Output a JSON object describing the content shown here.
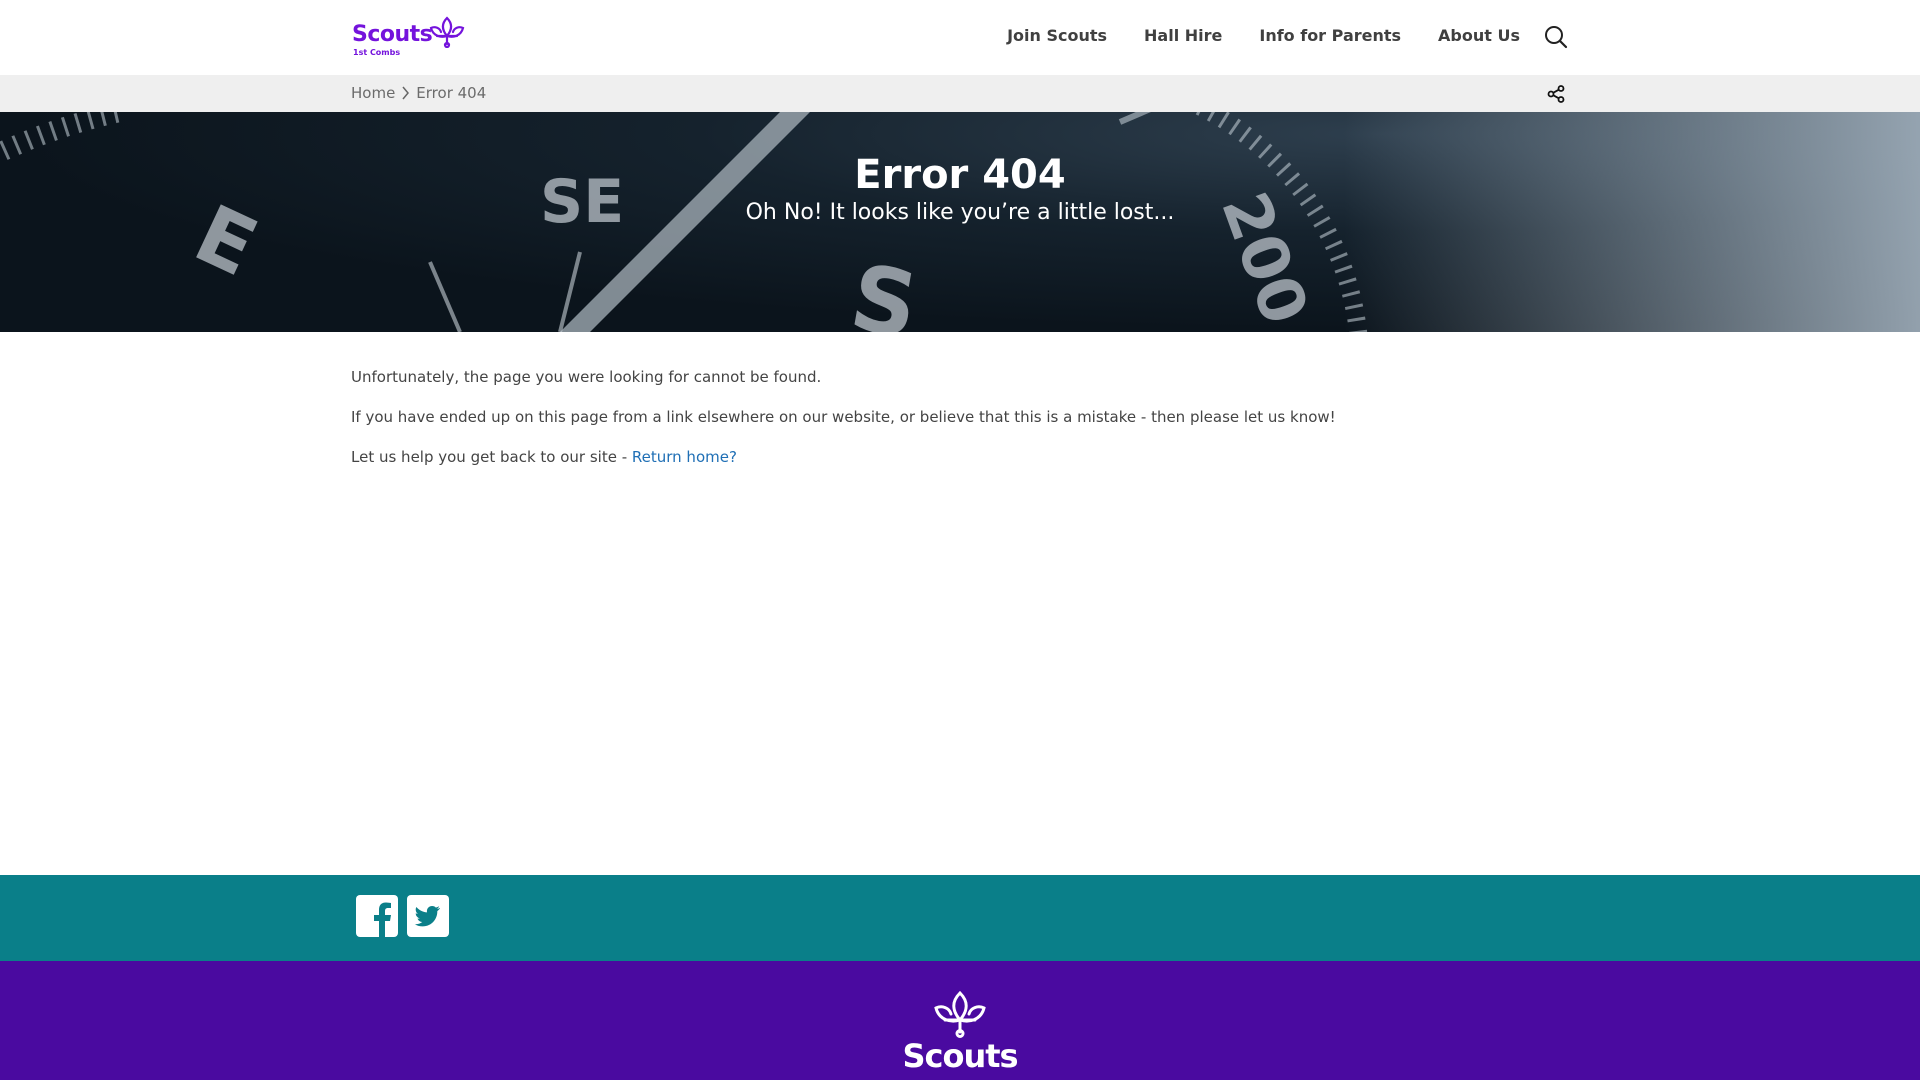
{
  "header": {
    "logo_text": "Scouts",
    "logo_sub": "1st Combs",
    "nav": [
      "Join Scouts",
      "Hall Hire",
      "Info for Parents",
      "About Us"
    ],
    "search_icon": "search-icon"
  },
  "breadcrumb": {
    "home": "Home",
    "current": "Error 404",
    "share_icon": "share-icon"
  },
  "hero": {
    "title": "Error 404",
    "subtitle": "Oh No! It looks like you’re a little lost..."
  },
  "content": {
    "p1": "Unfortunately, the page you were looking for cannot be found.",
    "p2": "If you have ended up on this page from a link elsewhere on our website, or believe that this is a mistake - then please let us know!",
    "p3_prefix": "Let us help you get back to our site - ",
    "p3_link": "Return home?"
  },
  "social": {
    "icons": [
      "facebook-icon",
      "twitter-icon"
    ],
    "color": "#0a7f89"
  },
  "footer": {
    "logo_text": "Scouts",
    "color": "#4a0aa0"
  },
  "colors": {
    "brand_purple": "#7413dc",
    "link": "#1f6fb5"
  }
}
